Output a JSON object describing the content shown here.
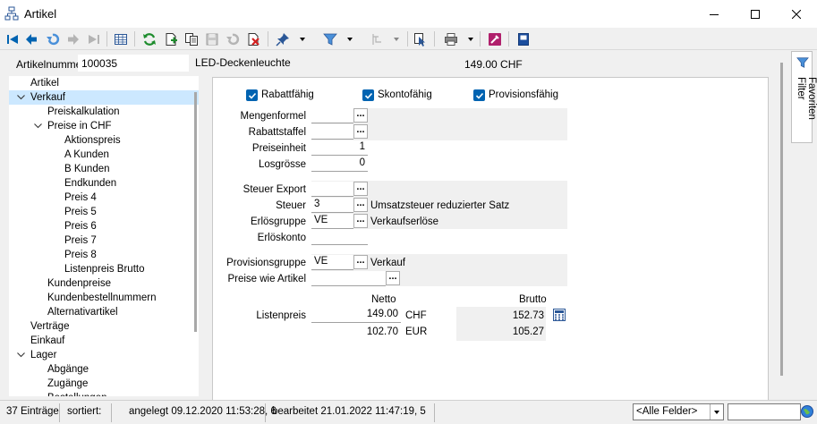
{
  "window": {
    "title": "Artikel"
  },
  "header": {
    "artikelnummer_label": "Artikelnummer",
    "artikelnummer": "100035",
    "artikel_name": "LED-Deckenleuchte",
    "price": "149.00  CHF"
  },
  "tree": [
    {
      "label": "Artikel",
      "level": 0,
      "chevron": ""
    },
    {
      "label": "Verkauf",
      "level": 0,
      "chevron": "down",
      "selected": true
    },
    {
      "label": "Preiskalkulation",
      "level": 1,
      "chevron": ""
    },
    {
      "label": "Preise in CHF",
      "level": 1,
      "chevron": "down"
    },
    {
      "label": "Aktionspreis",
      "level": 2,
      "chevron": ""
    },
    {
      "label": "A Kunden",
      "level": 2,
      "chevron": ""
    },
    {
      "label": "B Kunden",
      "level": 2,
      "chevron": ""
    },
    {
      "label": "Endkunden",
      "level": 2,
      "chevron": ""
    },
    {
      "label": "Preis 4",
      "level": 2,
      "chevron": ""
    },
    {
      "label": "Preis 5",
      "level": 2,
      "chevron": ""
    },
    {
      "label": "Preis 6",
      "level": 2,
      "chevron": ""
    },
    {
      "label": "Preis 7",
      "level": 2,
      "chevron": ""
    },
    {
      "label": "Preis 8",
      "level": 2,
      "chevron": ""
    },
    {
      "label": "Listenpreis Brutto",
      "level": 2,
      "chevron": ""
    },
    {
      "label": "Kundenpreise",
      "level": 1,
      "chevron": ""
    },
    {
      "label": "Kundenbestellnummern",
      "level": 1,
      "chevron": ""
    },
    {
      "label": "Alternativartikel",
      "level": 1,
      "chevron": ""
    },
    {
      "label": "Verträge",
      "level": 0,
      "chevron": ""
    },
    {
      "label": "Einkauf",
      "level": 0,
      "chevron": ""
    },
    {
      "label": "Lager",
      "level": 0,
      "chevron": "down"
    },
    {
      "label": "Abgänge",
      "level": 1,
      "chevron": ""
    },
    {
      "label": "Zugänge",
      "level": 1,
      "chevron": ""
    },
    {
      "label": "Bestellungen",
      "level": 1,
      "chevron": ""
    }
  ],
  "checkboxes": {
    "rabattfaehig": "Rabattfähig",
    "skontofaehig": "Skontofähig",
    "provisionsfaehig": "Provisionsfähig"
  },
  "fields": {
    "mengenformel": {
      "label": "Mengenformel",
      "value": ""
    },
    "rabattstaffel": {
      "label": "Rabattstaffel",
      "value": ""
    },
    "preiseinheit": {
      "label": "Preiseinheit",
      "value": "1"
    },
    "losgroesse": {
      "label": "Losgrösse",
      "value": "0"
    },
    "steuer_export": {
      "label": "Steuer Export",
      "value": ""
    },
    "steuer": {
      "label": "Steuer",
      "value": "3",
      "desc": "Umsatzsteuer reduzierter Satz"
    },
    "erloesgruppe": {
      "label": "Erlösgruppe",
      "value": "VE",
      "desc": "Verkaufserlöse"
    },
    "erloeskonto": {
      "label": "Erlöskonto",
      "value": ""
    },
    "provisionsgruppe": {
      "label": "Provisionsgruppe",
      "value": "VE",
      "desc": "Verkauf"
    },
    "preise_wie_artikel": {
      "label": "Preise wie Artikel",
      "value": ""
    }
  },
  "prices": {
    "netto_header": "Netto",
    "brutto_header": "Brutto",
    "listenpreis_label": "Listenpreis",
    "netto_chf": "149.00",
    "currency_chf": "CHF",
    "brutto_chf": "152.73",
    "netto_eur": "102.70",
    "currency_eur": "EUR",
    "brutto_eur": "105.27"
  },
  "favorites_tab": "Favoriten Filter",
  "status": {
    "count": "37 Einträge",
    "sorted": "sortiert:",
    "created": "angelegt 09.12.2020 11:53:28,  6",
    "edited": "bearbeitet 21.01.2022 11:47:19,  5",
    "filter_value": "<Alle Felder>"
  },
  "colors": {
    "accent": "#0063b1",
    "selection": "#cce8ff",
    "refresh_green": "#1e8c2d",
    "delete_red": "#d42020"
  }
}
